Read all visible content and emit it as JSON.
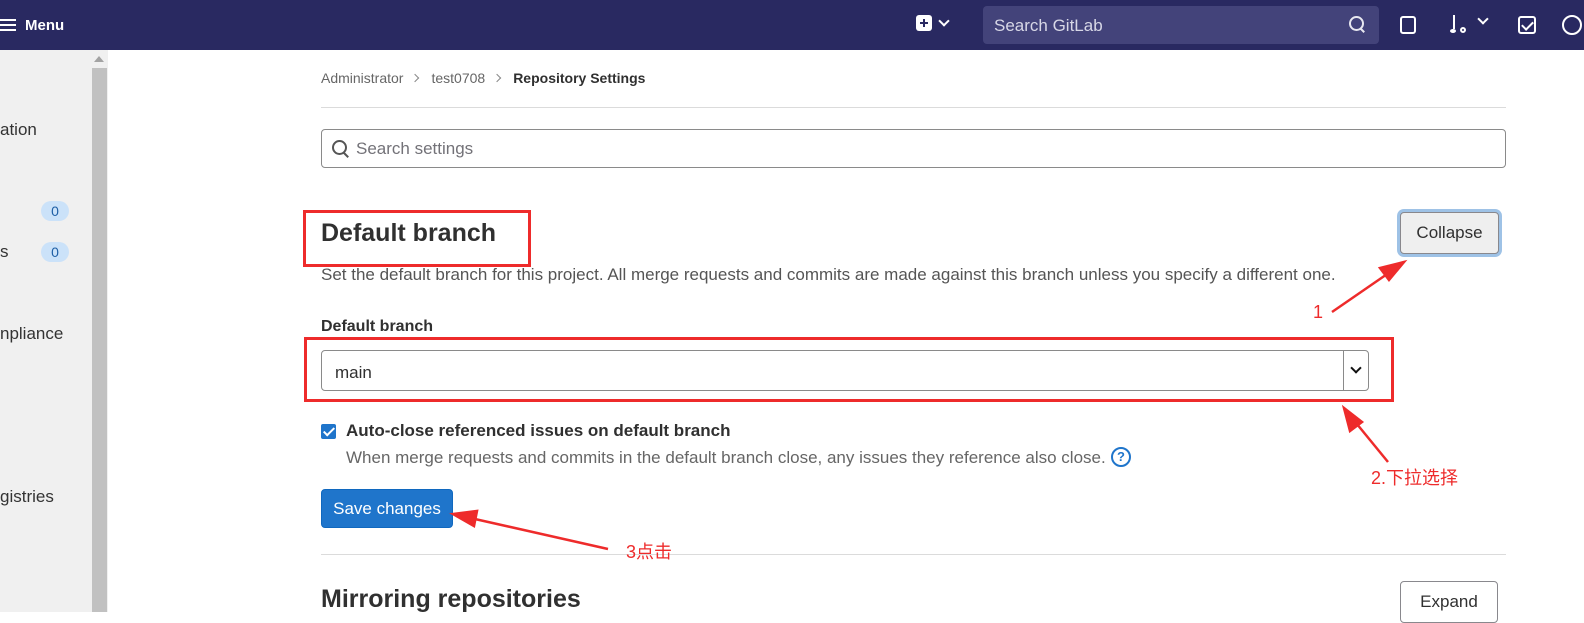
{
  "topbar": {
    "menu_label": "Menu",
    "search_placeholder": "Search GitLab"
  },
  "sidebar": {
    "items": [
      {
        "label": "ation"
      },
      {
        "label": "",
        "badge": "0"
      },
      {
        "label": "s",
        "badge": "0"
      },
      {
        "label": "npliance"
      },
      {
        "label": "gistries"
      }
    ]
  },
  "breadcrumb": [
    "Administrator",
    "test0708",
    "Repository Settings"
  ],
  "settings_search": {
    "placeholder": "Search settings",
    "value": ""
  },
  "default_branch_section": {
    "title": "Default branch",
    "collapse_label": "Collapse",
    "description": "Set the default branch for this project. All merge requests and commits are made against this branch unless you specify a different one.",
    "field_label": "Default branch",
    "selected_branch": "main",
    "auto_close": {
      "checked": true,
      "label": "Auto-close referenced issues on default branch",
      "help": "When merge requests and commits in the default branch close, any issues they reference also close."
    },
    "save_label": "Save changes"
  },
  "mirroring_section": {
    "title": "Mirroring repositories",
    "expand_label": "Expand"
  },
  "annotations": {
    "color": "#ee2b2b",
    "step1": "1",
    "step2": "2.下拉选择",
    "step3": "3点击"
  },
  "colors": {
    "topbar": "#292961",
    "primary": "#1f75cb",
    "annotation": "#ee2b2b"
  }
}
